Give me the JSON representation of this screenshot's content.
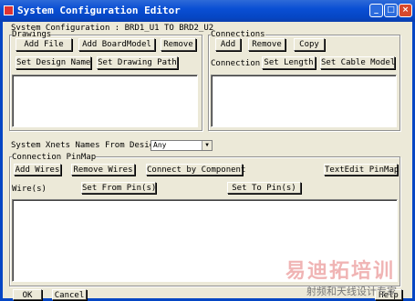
{
  "window": {
    "title": "System Configuration Editor",
    "controls": {
      "minimize": "_",
      "maximize": "□",
      "close": "×"
    }
  },
  "header": {
    "system_configuration": "System Configuration :  BRD1_U1 TO BRD2_U2"
  },
  "drawings": {
    "label": "Drawings",
    "add_file": "Add File",
    "add_boardmodel": "Add BoardModel",
    "remove": "Remove",
    "set_design_name": "Set Design Name",
    "set_drawing_path": "Set Drawing Path"
  },
  "connections": {
    "label": "Connections",
    "add": "Add",
    "remove": "Remove",
    "copy": "Copy",
    "connection_label": "Connection",
    "set_length": "Set Length",
    "set_cable_model": "Set Cable Model"
  },
  "xnets": {
    "label": "System Xnets Names From Design:",
    "selected": "Any"
  },
  "pinmap": {
    "label": "Connection PinMap",
    "add_wires": "Add Wires",
    "remove_wires": "Remove Wires",
    "connect_by_component": "Connect by Component",
    "textedit_pinmap": "TextEdit PinMap",
    "wires_label": "Wire(s)",
    "set_from_pins": "Set From Pin(s)",
    "set_to_pins": "Set To Pin(s)"
  },
  "footer": {
    "ok": "OK",
    "cancel": "Cancel",
    "help": "Help"
  },
  "watermark": {
    "main": "易迪拓培训",
    "sub": "射频和天线设计专家"
  },
  "colors": {
    "titlebar": "#0546c4",
    "face": "#ece9d8",
    "close": "#d7492d"
  }
}
